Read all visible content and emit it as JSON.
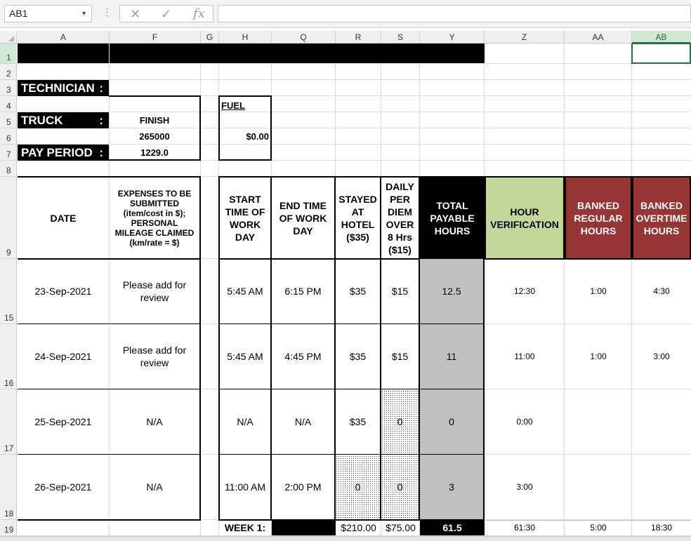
{
  "toolbar": {
    "name_box": "AB1",
    "formula_value": "",
    "cancel_icon": "cancel-icon",
    "enter_icon": "check-icon",
    "function_icon": "fx-icon"
  },
  "columns": [
    "A",
    "F",
    "G",
    "H",
    "Q",
    "R",
    "S",
    "Y",
    "Z",
    "AA",
    "AB"
  ],
  "rows": [
    "1",
    "2",
    "3",
    "4",
    "5",
    "6",
    "7",
    "8",
    "9",
    "15",
    "16",
    "17",
    "18",
    "19"
  ],
  "labels": {
    "technician": "TECHNICIAN",
    "truck": "TRUCK",
    "pay_period": "PAY PERIOD",
    "colon": ":",
    "fuel": "FUEL",
    "finish": "FINISH",
    "odometer": "265000",
    "pay_value": "1229.0",
    "fuel_value": "$0.00"
  },
  "table_headers": {
    "date": "DATE",
    "expenses": "EXPENSES TO BE SUBMITTED (item/cost in $); PERSONAL MILEAGE CLAIMED (km/rate = $)",
    "start": "START TIME OF WORK DAY",
    "end": "END TIME OF WORK DAY",
    "hotel": "STAYED AT HOTEL ($35)",
    "per_diem": "DAILY PER DIEM OVER 8 Hrs ($15)",
    "total": "TOTAL PAYABLE HOURS",
    "verify": "HOUR VERIFICATION",
    "banked_reg": "BANKED REGULAR HOURS",
    "banked_ot": "BANKED OVERTIME HOURS"
  },
  "table_rows": [
    {
      "date": "23-Sep-2021",
      "expenses": "Please add for review",
      "start": "5:45 AM",
      "end": "6:15 PM",
      "hotel": "$35",
      "per_diem": "$15",
      "total": "12.5",
      "verify": "12:30",
      "banked_reg": "1:00",
      "banked_ot": "4:30"
    },
    {
      "date": "24-Sep-2021",
      "expenses": "Please add for review",
      "start": "5:45 AM",
      "end": "4:45 PM",
      "hotel": "$35",
      "per_diem": "$15",
      "total": "11",
      "verify": "11:00",
      "banked_reg": "1:00",
      "banked_ot": "3:00"
    },
    {
      "date": "25-Sep-2021",
      "expenses": "N/A",
      "start": "N/A",
      "end": "N/A",
      "hotel": "$35",
      "per_diem": "0",
      "total": "0",
      "verify": "0:00",
      "banked_reg": "",
      "banked_ot": ""
    },
    {
      "date": "26-Sep-2021",
      "expenses": "N/A",
      "start": "11:00 AM",
      "end": "2:00 PM",
      "hotel": "0",
      "per_diem": "0",
      "total": "3",
      "verify": "3:00",
      "banked_reg": "",
      "banked_ot": ""
    }
  ],
  "week_summary": {
    "label": "WEEK 1:",
    "hotel": "$210.00",
    "per_diem": "$75.00",
    "total": "61.5",
    "verify": "61:30",
    "banked_reg": "5:00",
    "banked_ot": "18:30"
  },
  "colors": {
    "accent_green": "#217346",
    "verification_fill": "#c4d79b",
    "banked_fill": "#963634",
    "total_fill": "#c0c0c0"
  }
}
